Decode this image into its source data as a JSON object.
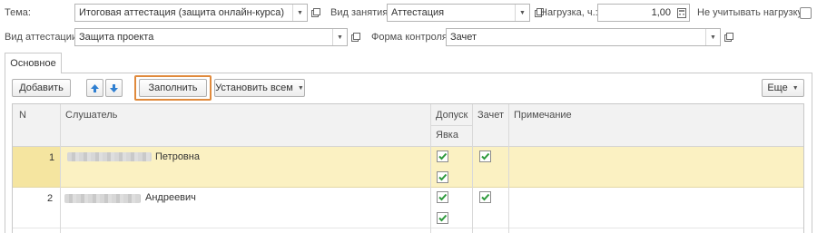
{
  "header": {
    "tema_label": "Тема:",
    "tema_value": "Итоговая аттестация (защита онлайн-курса)",
    "vid_zanyatiya_label": "Вид занятия:",
    "vid_zanyatiya_value": "Аттестация",
    "nagruzka_label": "Нагрузка, ч.:",
    "nagruzka_value": "1,00",
    "ne_uchityvat_label": "Не учитывать нагрузку:",
    "vid_attestacii_label": "Вид аттестации:",
    "vid_attestacii_value": "Защита проекта",
    "forma_kontrolya_label": "Форма контроля:",
    "forma_kontrolya_value": "Зачет"
  },
  "tabs": [
    {
      "label": "Основное"
    }
  ],
  "toolbar": {
    "add_label": "Добавить",
    "fill_label": "Заполнить",
    "set_all_label": "Установить всем",
    "more_label": "Еще"
  },
  "table": {
    "columns": {
      "n": "N",
      "listener": "Слушатель",
      "dopusk": "Допуск",
      "yavka": "Явка",
      "zachet": "Зачет",
      "note": "Примечание"
    },
    "rows": [
      {
        "n": "1",
        "listener_visible": "Петровна",
        "dopusk": true,
        "yavka": true,
        "zachet": true,
        "note": ""
      },
      {
        "n": "2",
        "listener_visible": "Андреевич",
        "dopusk": true,
        "yavka": true,
        "zachet": true,
        "note": ""
      }
    ]
  },
  "colors": {
    "selected_row": "#fbf1c2",
    "highlight_border": "#e08a3c",
    "check_green": "#2e9a3c",
    "arrow_blue": "#2f7fd1"
  }
}
